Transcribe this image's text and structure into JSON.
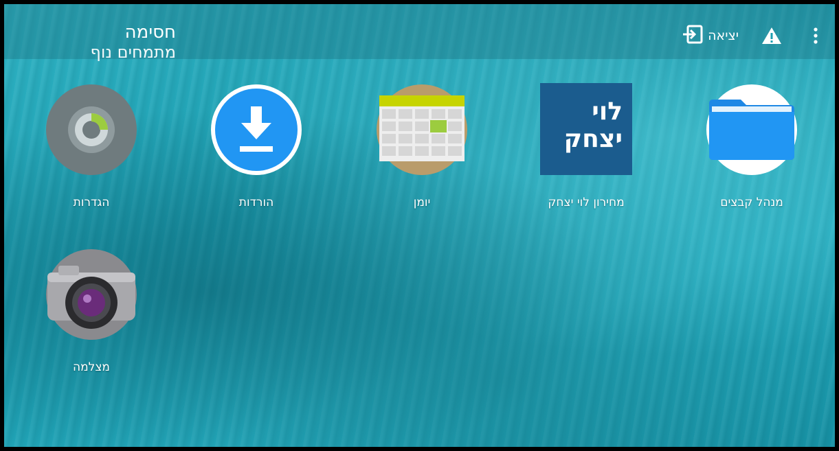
{
  "topbar": {
    "title": "חסימה",
    "subtitle": "מתמחים נוף",
    "exit_label": "יציאה",
    "exit_icon": "exit-icon",
    "warning_icon": "warning-icon",
    "more_icon": "more-vert-icon"
  },
  "apps": [
    {
      "label": "מנהל קבצים",
      "icon": "folder-icon",
      "color": "#2196f3"
    },
    {
      "label": "מחירון לוי יצחק",
      "icon": "levi-yitzhak-logo-icon",
      "logo_text": [
        "לוי",
        "יצחק"
      ],
      "color": "#1b5c8e"
    },
    {
      "label": "יומן",
      "icon": "calendar-icon",
      "color": "#c8d400"
    },
    {
      "label": "הורדות",
      "icon": "download-icon",
      "color": "#2196f3"
    },
    {
      "label": "הגדרות",
      "icon": "settings-gear-icon",
      "color": "#6f7b7e"
    },
    {
      "label": "מצלמה",
      "icon": "camera-icon",
      "color": "#8e8e92"
    }
  ]
}
